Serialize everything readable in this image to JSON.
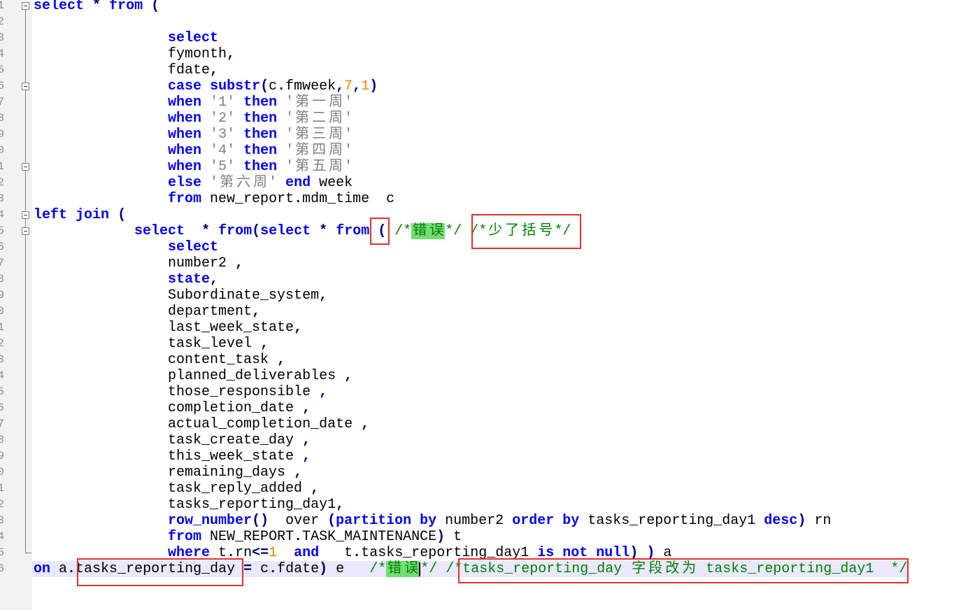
{
  "colors": {
    "keyword": "#0000ff",
    "operator": "#000080",
    "text": "#000000",
    "string": "#808080",
    "number": "#ff8000",
    "comment": "#008000",
    "smart_highlight": "#74dc74",
    "current_line": "#e8e8ff",
    "annotation_box": "#e3312e",
    "line_number": "#8c8c8c",
    "gutter": "#f2f2f2"
  },
  "editor": {
    "lines": [
      {
        "n": 1,
        "fold_icon": "fold-collapse-icon",
        "tokens": [
          {
            "kw": "select"
          },
          {
            "tx": " "
          },
          {
            "op": "*"
          },
          {
            "tx": " "
          },
          {
            "kw": "from"
          },
          {
            "tx": " "
          },
          {
            "op": "("
          }
        ]
      },
      {
        "n": 2,
        "fold_icon": "fold-line",
        "tokens": []
      },
      {
        "n": 3,
        "fold_icon": "fold-line",
        "tokens": [
          {
            "tx": "                "
          },
          {
            "kw": "select"
          }
        ]
      },
      {
        "n": 4,
        "fold_icon": "fold-line",
        "tokens": [
          {
            "tx": "                fymonth"
          },
          {
            "op": ","
          }
        ]
      },
      {
        "n": 5,
        "fold_icon": "fold-line",
        "tokens": [
          {
            "tx": "                fdate"
          },
          {
            "op": ","
          }
        ]
      },
      {
        "n": 6,
        "fold_icon": "fold-collapse-nested-icon",
        "tokens": [
          {
            "tx": "                "
          },
          {
            "kw": "case"
          },
          {
            "tx": " "
          },
          {
            "kw": "substr"
          },
          {
            "op": "("
          },
          {
            "tx": "c"
          },
          {
            "op": "."
          },
          {
            "tx": "fmweek"
          },
          {
            "op": ","
          },
          {
            "num": "7"
          },
          {
            "op": ","
          },
          {
            "num": "1"
          },
          {
            "op": ")"
          }
        ]
      },
      {
        "n": 7,
        "fold_icon": "fold-line",
        "tokens": [
          {
            "tx": "                "
          },
          {
            "kw": "when"
          },
          {
            "tx": " "
          },
          {
            "str": "'1'"
          },
          {
            "tx": " "
          },
          {
            "kw": "then"
          },
          {
            "tx": " "
          },
          {
            "str": "'第一周'"
          }
        ]
      },
      {
        "n": 8,
        "fold_icon": "fold-line",
        "tokens": [
          {
            "tx": "                "
          },
          {
            "kw": "when"
          },
          {
            "tx": " "
          },
          {
            "str": "'2'"
          },
          {
            "tx": " "
          },
          {
            "kw": "then"
          },
          {
            "tx": " "
          },
          {
            "str": "'第二周'"
          }
        ]
      },
      {
        "n": 9,
        "fold_icon": "fold-line",
        "tokens": [
          {
            "tx": "                "
          },
          {
            "kw": "when"
          },
          {
            "tx": " "
          },
          {
            "str": "'3'"
          },
          {
            "tx": " "
          },
          {
            "kw": "then"
          },
          {
            "tx": " "
          },
          {
            "str": "'第三周'"
          }
        ]
      },
      {
        "n": 10,
        "fold_icon": "fold-line",
        "tokens": [
          {
            "tx": "                "
          },
          {
            "kw": "when"
          },
          {
            "tx": " "
          },
          {
            "str": "'4'"
          },
          {
            "tx": " "
          },
          {
            "kw": "then"
          },
          {
            "tx": " "
          },
          {
            "str": "'第四周'"
          }
        ]
      },
      {
        "n": 11,
        "fold_icon": "fold-collapse-nested-icon",
        "tokens": [
          {
            "tx": "                "
          },
          {
            "kw": "when"
          },
          {
            "tx": " "
          },
          {
            "str": "'5'"
          },
          {
            "tx": " "
          },
          {
            "kw": "then"
          },
          {
            "tx": " "
          },
          {
            "str": "'第五周'"
          }
        ]
      },
      {
        "n": 12,
        "fold_icon": "fold-line",
        "tokens": [
          {
            "tx": "                "
          },
          {
            "kw": "else"
          },
          {
            "tx": " "
          },
          {
            "str": "'第六周'"
          },
          {
            "tx": " "
          },
          {
            "kw": "end"
          },
          {
            "tx": " week"
          }
        ]
      },
      {
        "n": 13,
        "fold_icon": "fold-line",
        "tokens": [
          {
            "tx": "                "
          },
          {
            "kw": "from"
          },
          {
            "tx": " new_report"
          },
          {
            "op": "."
          },
          {
            "tx": "mdm_time  c"
          }
        ]
      },
      {
        "n": 14,
        "fold_icon": "fold-collapse-nested-icon",
        "tokens": [
          {
            "kw": "left"
          },
          {
            "tx": " "
          },
          {
            "kw": "join"
          },
          {
            "tx": " "
          },
          {
            "op": "("
          }
        ]
      },
      {
        "n": 15,
        "fold_icon": "fold-collapse-nested-icon",
        "tokens": [
          {
            "tx": "            "
          },
          {
            "kw": "select"
          },
          {
            "tx": "  "
          },
          {
            "op": "*"
          },
          {
            "tx": " "
          },
          {
            "kw": "from"
          },
          {
            "op": "("
          },
          {
            "kw": "select"
          },
          {
            "tx": " "
          },
          {
            "op": "*"
          },
          {
            "tx": " "
          },
          {
            "kw": "from"
          },
          {
            "tx": " "
          },
          {
            "op": "("
          },
          {
            "tx": " "
          },
          {
            "cm": "/*"
          },
          {
            "hl": "错误"
          },
          {
            "cm": "*/"
          },
          {
            "tx": " "
          },
          {
            "cm": "/*少了括号*/"
          }
        ]
      },
      {
        "n": 16,
        "fold_icon": "fold-line",
        "tokens": [
          {
            "tx": "                "
          },
          {
            "kw": "select"
          }
        ]
      },
      {
        "n": 17,
        "fold_icon": "fold-line",
        "tokens": [
          {
            "tx": "                number2 "
          },
          {
            "op": ","
          }
        ]
      },
      {
        "n": 18,
        "fold_icon": "fold-line",
        "tokens": [
          {
            "tx": "                "
          },
          {
            "kw": "state"
          },
          {
            "op": ","
          }
        ]
      },
      {
        "n": 19,
        "fold_icon": "fold-line",
        "tokens": [
          {
            "tx": "                Subordinate_system"
          },
          {
            "op": ","
          }
        ]
      },
      {
        "n": 20,
        "fold_icon": "fold-line",
        "tokens": [
          {
            "tx": "                department"
          },
          {
            "op": ","
          }
        ]
      },
      {
        "n": 21,
        "fold_icon": "fold-line",
        "tokens": [
          {
            "tx": "                last_week_state"
          },
          {
            "op": ","
          }
        ]
      },
      {
        "n": 22,
        "fold_icon": "fold-line",
        "tokens": [
          {
            "tx": "                task_level "
          },
          {
            "op": ","
          }
        ]
      },
      {
        "n": 23,
        "fold_icon": "fold-line",
        "tokens": [
          {
            "tx": "                content_task "
          },
          {
            "op": ","
          }
        ]
      },
      {
        "n": 24,
        "fold_icon": "fold-line",
        "tokens": [
          {
            "tx": "                planned_deliverables "
          },
          {
            "op": ","
          }
        ]
      },
      {
        "n": 25,
        "fold_icon": "fold-line",
        "tokens": [
          {
            "tx": "                those_responsible "
          },
          {
            "op": ","
          }
        ]
      },
      {
        "n": 26,
        "fold_icon": "fold-line",
        "tokens": [
          {
            "tx": "                completion_date "
          },
          {
            "op": ","
          }
        ]
      },
      {
        "n": 27,
        "fold_icon": "fold-line",
        "tokens": [
          {
            "tx": "                actual_completion_date "
          },
          {
            "op": ","
          }
        ]
      },
      {
        "n": 28,
        "fold_icon": "fold-line",
        "tokens": [
          {
            "tx": "                task_create_day "
          },
          {
            "op": ","
          }
        ]
      },
      {
        "n": 29,
        "fold_icon": "fold-line",
        "tokens": [
          {
            "tx": "                this_week_state "
          },
          {
            "op": ","
          }
        ]
      },
      {
        "n": 30,
        "fold_icon": "fold-line",
        "tokens": [
          {
            "tx": "                remaining_days "
          },
          {
            "op": ","
          }
        ]
      },
      {
        "n": 31,
        "fold_icon": "fold-line",
        "tokens": [
          {
            "tx": "                task_reply_added "
          },
          {
            "op": ","
          }
        ]
      },
      {
        "n": 32,
        "fold_icon": "fold-line",
        "tokens": [
          {
            "tx": "                tasks_reporting_day1"
          },
          {
            "op": ","
          }
        ]
      },
      {
        "n": 33,
        "fold_icon": "fold-line",
        "tokens": [
          {
            "tx": "                "
          },
          {
            "kw": "row_number"
          },
          {
            "op": "()"
          },
          {
            "tx": "  over "
          },
          {
            "op": "("
          },
          {
            "kw": "partition"
          },
          {
            "tx": " "
          },
          {
            "kw": "by"
          },
          {
            "tx": " number2 "
          },
          {
            "kw": "order"
          },
          {
            "tx": " "
          },
          {
            "kw": "by"
          },
          {
            "tx": " tasks_reporting_day1 "
          },
          {
            "kw": "desc"
          },
          {
            "op": ")"
          },
          {
            "tx": " rn"
          }
        ]
      },
      {
        "n": 34,
        "fold_icon": "fold-line",
        "tokens": [
          {
            "tx": "                "
          },
          {
            "kw": "from"
          },
          {
            "tx": " NEW_REPORT"
          },
          {
            "op": "."
          },
          {
            "tx": "TASK_MAINTENANCE"
          },
          {
            "op": ")"
          },
          {
            "tx": " t"
          }
        ]
      },
      {
        "n": 35,
        "fold_icon": "fold-end-corner",
        "tokens": [
          {
            "tx": "                "
          },
          {
            "kw": "where"
          },
          {
            "tx": " t"
          },
          {
            "op": "."
          },
          {
            "tx": "rn"
          },
          {
            "op": "<="
          },
          {
            "num": "1"
          },
          {
            "tx": "  "
          },
          {
            "kw": "and"
          },
          {
            "tx": "   t"
          },
          {
            "op": "."
          },
          {
            "tx": "tasks_reporting_day1 "
          },
          {
            "kw": "is"
          },
          {
            "tx": " "
          },
          {
            "kw": "not"
          },
          {
            "tx": " "
          },
          {
            "kw": "null"
          },
          {
            "op": ")"
          },
          {
            "tx": " "
          },
          {
            "op": ")"
          },
          {
            "tx": " a"
          }
        ]
      },
      {
        "n": 36,
        "current": true,
        "tokens": [
          {
            "kw": "on"
          },
          {
            "tx": " a"
          },
          {
            "op": "."
          },
          {
            "tx": "tasks_reporting_day "
          },
          {
            "op": "="
          },
          {
            "tx": " c"
          },
          {
            "op": "."
          },
          {
            "tx": "fdate"
          },
          {
            "op": ")"
          },
          {
            "tx": " e   "
          },
          {
            "cm": "/*"
          },
          {
            "hl": "错误"
          },
          {
            "caret": ""
          },
          {
            "cm": "*/"
          },
          {
            "tx": " "
          },
          {
            "cm": "/*tasks_reporting_day 字段改为 tasks_reporting_day1  */"
          }
        ]
      }
    ]
  }
}
